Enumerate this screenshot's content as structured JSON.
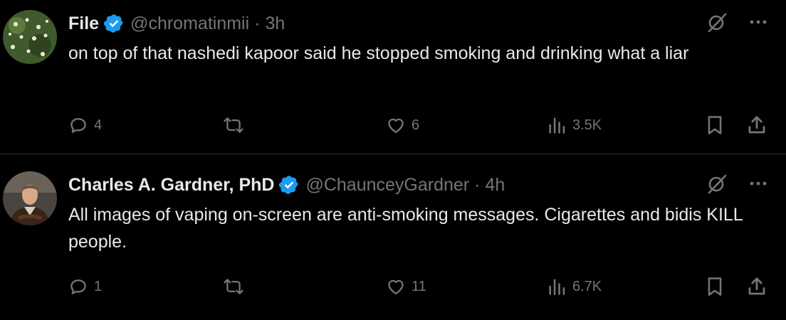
{
  "tweets": [
    {
      "name": "File",
      "handle": "@chromatinmii",
      "separator": "·",
      "time": "3h",
      "text": "on top of that nashedi kapoor said he stopped smoking and drinking what a liar",
      "replies": "4",
      "likes": "6",
      "views": "3.5K"
    },
    {
      "name": "Charles A. Gardner, PhD",
      "handle": "@ChaunceyGardner",
      "separator": "·",
      "time": "4h",
      "text": "All images of vaping on-screen are anti-smoking messages.  Cigarettes and bidis KILL people.",
      "replies": "1",
      "likes": "11",
      "views": "6.7K"
    }
  ],
  "colors": {
    "background": "#000000",
    "text": "#e7e9ea",
    "muted": "#71767b",
    "verified": "#1d9bf0",
    "divider": "#2f3336"
  },
  "icons": [
    "verified-badge-icon",
    "grok-icon",
    "more-icon",
    "reply-icon",
    "retweet-icon",
    "like-icon",
    "views-icon",
    "bookmark-icon",
    "share-icon"
  ]
}
